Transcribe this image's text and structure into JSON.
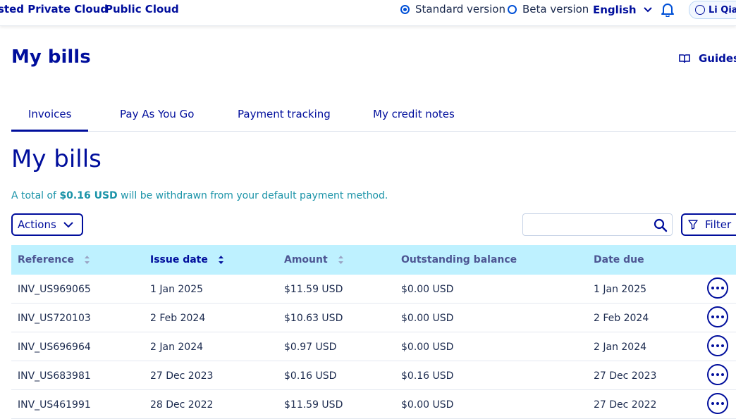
{
  "topbar": {
    "nav": [
      "sted Private Cloud",
      "Public Cloud"
    ],
    "version_standard": "Standard version",
    "version_beta": "Beta version",
    "language": "English",
    "user": "Li Qian"
  },
  "header": {
    "title": "My bills",
    "guides": "Guides"
  },
  "tabs": [
    "Invoices",
    "Pay As You Go",
    "Payment tracking",
    "My credit notes"
  ],
  "main": {
    "title": "My bills",
    "info_prefix": "A total of ",
    "info_amount": "$0.16 USD",
    "info_suffix": " will be withdrawn from your default payment method.",
    "actions_label": "Actions",
    "search_placeholder": "",
    "filter_label": "Filter"
  },
  "table": {
    "columns": [
      "Reference",
      "Issue date",
      "Amount",
      "Outstanding balance",
      "Date due"
    ],
    "rows": [
      {
        "reference": "INV_US969065",
        "issue_date": "1 Jan 2025",
        "amount": "$11.59 USD",
        "balance": "$0.00 USD",
        "due": "1 Jan 2025"
      },
      {
        "reference": "INV_US720103",
        "issue_date": "2 Feb 2024",
        "amount": "$10.63 USD",
        "balance": "$0.00 USD",
        "due": "2 Feb 2024"
      },
      {
        "reference": "INV_US696964",
        "issue_date": "2 Jan 2024",
        "amount": "$0.97 USD",
        "balance": "$0.00 USD",
        "due": "2 Jan 2024"
      },
      {
        "reference": "INV_US683981",
        "issue_date": "27 Dec 2023",
        "amount": "$0.16 USD",
        "balance": "$0.16 USD",
        "due": "27 Dec 2023"
      },
      {
        "reference": "INV_US461991",
        "issue_date": "28 Dec 2022",
        "amount": "$11.59 USD",
        "balance": "$0.00 USD",
        "due": "27 Dec 2022"
      }
    ]
  },
  "colors": {
    "primary": "#000e9c",
    "accent": "#0050d7",
    "header_bg": "#bef1ff",
    "info_text": "#1a93a8"
  },
  "icons": [
    "bell-icon",
    "user-icon",
    "book-icon",
    "chevron-down-icon",
    "search-icon",
    "filter-icon",
    "sort-icon",
    "more-icon"
  ]
}
